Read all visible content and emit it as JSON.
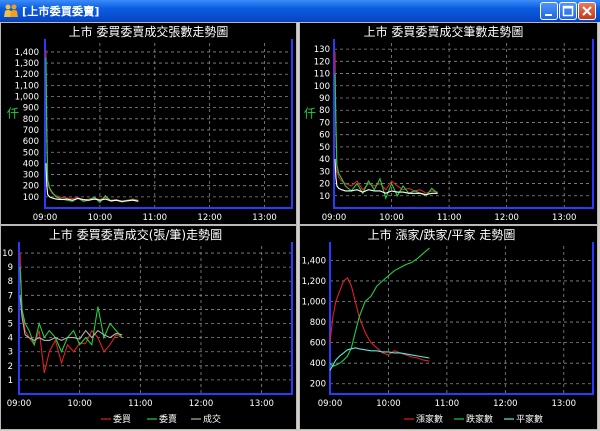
{
  "window": {
    "title": "[上市委買委賣]",
    "colors": {
      "titlebar": "#0a5ce0",
      "axis": "#2a3bff",
      "grid": "#8a8a8a",
      "text": "#ffffff"
    },
    "icons": {
      "app": "people-icon",
      "minimize": "minimize-icon",
      "maximize": "maximize-icon",
      "close": "close-icon"
    }
  },
  "chart_data": [
    {
      "type": "line",
      "title": "上市  委買委賣成交張數走勢圖",
      "ylabel": "仟",
      "x_ticks": [
        "09:00",
        "10:00",
        "11:00",
        "12:00",
        "13:00"
      ],
      "x_range": [
        "09:00",
        "13:30"
      ],
      "ylim": [
        0,
        1480
      ],
      "y_ticks": [
        100,
        200,
        300,
        400,
        500,
        600,
        700,
        800,
        900,
        1000,
        1100,
        1200,
        1300,
        1400
      ],
      "y_tick_labels": [
        "100",
        "200",
        "300",
        "400",
        "500",
        "600",
        "700",
        "800",
        "900",
        "1,000",
        "1,100",
        "1,200",
        "1,300",
        "1,400"
      ],
      "grid": true,
      "legend": "none",
      "series": [
        {
          "color": "#e02020",
          "x": [
            "09:01",
            "09:02",
            "09:03",
            "09:05",
            "09:08",
            "09:12",
            "09:18",
            "09:24",
            "09:30",
            "09:36",
            "09:42",
            "09:48",
            "09:54",
            "10:00",
            "10:06",
            "10:12",
            "10:18",
            "10:24",
            "10:30",
            "10:36",
            "10:42"
          ],
          "values": [
            1420,
            600,
            220,
            170,
            130,
            110,
            95,
            90,
            85,
            95,
            70,
            80,
            90,
            75,
            95,
            70,
            75,
            60,
            70,
            80,
            70
          ]
        },
        {
          "color": "#20d040",
          "x": [
            "09:01",
            "09:02",
            "09:03",
            "09:05",
            "09:08",
            "09:12",
            "09:18",
            "09:24",
            "09:30",
            "09:36",
            "09:42",
            "09:48",
            "09:54",
            "10:00",
            "10:06",
            "10:12",
            "10:18",
            "10:24",
            "10:30",
            "10:36",
            "10:42"
          ],
          "values": [
            1350,
            700,
            250,
            180,
            140,
            100,
            80,
            70,
            60,
            90,
            60,
            70,
            100,
            50,
            110,
            60,
            70,
            55,
            65,
            75,
            65
          ]
        },
        {
          "color": "#ffffff",
          "x": [
            "09:01",
            "09:02",
            "09:03",
            "09:05",
            "09:08",
            "09:12",
            "09:18",
            "09:24",
            "09:30",
            "09:36",
            "09:42",
            "09:48",
            "09:54",
            "10:00",
            "10:06",
            "10:12",
            "10:18",
            "10:24",
            "10:30",
            "10:36",
            "10:42"
          ],
          "values": [
            400,
            200,
            120,
            100,
            90,
            80,
            75,
            80,
            70,
            85,
            75,
            70,
            80,
            70,
            80,
            65,
            70,
            60,
            65,
            70,
            60
          ]
        }
      ]
    },
    {
      "type": "line",
      "title": "上市  委買委賣成交筆數走勢圖",
      "ylabel": "仟",
      "x_ticks": [
        "09:00",
        "10:00",
        "11:00",
        "12:00",
        "13:00"
      ],
      "x_range": [
        "09:00",
        "13:30"
      ],
      "ylim": [
        0,
        135
      ],
      "y_ticks": [
        10,
        20,
        30,
        40,
        50,
        60,
        70,
        80,
        90,
        100,
        110,
        120,
        130
      ],
      "y_tick_labels": [
        "10",
        "20",
        "30",
        "40",
        "50",
        "60",
        "70",
        "80",
        "90",
        "100",
        "110",
        "120",
        "130"
      ],
      "grid": true,
      "legend": "none",
      "series": [
        {
          "color": "#e02020",
          "x": [
            "09:01",
            "09:02",
            "09:03",
            "09:05",
            "09:08",
            "09:12",
            "09:18",
            "09:24",
            "09:30",
            "09:36",
            "09:42",
            "09:48",
            "09:54",
            "10:00",
            "10:06",
            "10:12",
            "10:18",
            "10:24",
            "10:30",
            "10:36",
            "10:42",
            "10:48"
          ],
          "values": [
            128,
            60,
            30,
            25,
            22,
            20,
            18,
            22,
            15,
            20,
            18,
            20,
            15,
            22,
            18,
            15,
            16,
            14,
            15,
            12,
            14,
            13
          ]
        },
        {
          "color": "#20d040",
          "x": [
            "09:01",
            "09:02",
            "09:03",
            "09:05",
            "09:08",
            "09:12",
            "09:18",
            "09:24",
            "09:30",
            "09:36",
            "09:42",
            "09:48",
            "09:54",
            "10:00",
            "10:06",
            "10:12",
            "10:18",
            "10:24",
            "10:30",
            "10:36",
            "10:42",
            "10:48"
          ],
          "values": [
            110,
            70,
            35,
            28,
            24,
            18,
            14,
            20,
            12,
            22,
            15,
            24,
            8,
            20,
            10,
            18,
            12,
            14,
            12,
            10,
            16,
            12
          ]
        },
        {
          "color": "#ffffff",
          "x": [
            "09:01",
            "09:02",
            "09:03",
            "09:05",
            "09:08",
            "09:12",
            "09:18",
            "09:24",
            "09:30",
            "09:36",
            "09:42",
            "09:48",
            "09:54",
            "10:00",
            "10:06",
            "10:12",
            "10:18",
            "10:24",
            "10:30",
            "10:36",
            "10:42",
            "10:48"
          ],
          "values": [
            40,
            25,
            18,
            16,
            15,
            14,
            14,
            15,
            13,
            15,
            14,
            14,
            12,
            14,
            13,
            13,
            12,
            12,
            12,
            11,
            12,
            12
          ]
        }
      ]
    },
    {
      "type": "line",
      "title": "上市  委買委賣成交(張/筆)走勢圖",
      "x_ticks": [
        "09:00",
        "10:00",
        "11:00",
        "12:00",
        "13:00"
      ],
      "x_range": [
        "09:00",
        "13:30"
      ],
      "ylim": [
        0,
        10.5
      ],
      "y_ticks": [
        1,
        2,
        3,
        4,
        5,
        6,
        7,
        8,
        9,
        10
      ],
      "y_tick_labels": [
        "1",
        "2",
        "3",
        "4",
        "5",
        "6",
        "7",
        "8",
        "9",
        "10"
      ],
      "grid": true,
      "legend": "bottom",
      "series": [
        {
          "name": "委買",
          "color": "#e02020",
          "x": [
            "09:01",
            "09:03",
            "09:06",
            "09:10",
            "09:15",
            "09:20",
            "09:25",
            "09:30",
            "09:36",
            "09:42",
            "09:48",
            "09:54",
            "10:00",
            "10:06",
            "10:12",
            "10:18",
            "10:24",
            "10:30",
            "10:36",
            "10:42"
          ],
          "values": [
            10,
            6,
            4.5,
            4,
            3.5,
            4.5,
            1.5,
            3,
            3.8,
            2.2,
            3.5,
            3,
            3.6,
            3.6,
            4.5,
            4,
            3,
            3.5,
            4.2,
            4
          ]
        },
        {
          "name": "委賣",
          "color": "#20d040",
          "x": [
            "09:01",
            "09:03",
            "09:06",
            "09:10",
            "09:15",
            "09:20",
            "09:25",
            "09:30",
            "09:36",
            "09:42",
            "09:48",
            "09:54",
            "10:00",
            "10:06",
            "10:12",
            "10:18",
            "10:24",
            "10:30",
            "10:36",
            "10:42"
          ],
          "values": [
            9,
            6,
            5,
            4.5,
            3.5,
            5,
            4,
            4.5,
            4,
            3,
            4,
            4.5,
            3.5,
            4,
            3.5,
            6.2,
            4,
            5,
            4.5,
            4
          ]
        },
        {
          "name": "成交",
          "color": "#b0b0b0",
          "x": [
            "09:01",
            "09:03",
            "09:06",
            "09:10",
            "09:15",
            "09:20",
            "09:25",
            "09:30",
            "09:36",
            "09:42",
            "09:48",
            "09:54",
            "10:00",
            "10:06",
            "10:12",
            "10:18",
            "10:24",
            "10:30",
            "10:36",
            "10:42"
          ],
          "values": [
            7,
            5.5,
            4.2,
            4,
            3.8,
            4,
            3.8,
            3.8,
            4,
            3.8,
            4,
            4,
            3.9,
            4.5,
            4,
            4.5,
            4.2,
            4,
            4.3,
            4.2
          ]
        }
      ]
    },
    {
      "type": "line",
      "title": "上市  漲家/跌家/平家 走勢圖",
      "x_ticks": [
        "09:00",
        "10:00",
        "11:00",
        "12:00",
        "13:00"
      ],
      "x_range": [
        "09:00",
        "13:30"
      ],
      "ylim": [
        100,
        1540
      ],
      "y_ticks": [
        200,
        400,
        600,
        800,
        1000,
        1200,
        1400
      ],
      "y_tick_labels": [
        "200",
        "400",
        "600",
        "800",
        "1,000",
        "1,200",
        "1,400"
      ],
      "grid": true,
      "legend": "bottom",
      "series": [
        {
          "name": "漲家數",
          "color": "#e02020",
          "x": [
            "09:00",
            "09:03",
            "09:06",
            "09:10",
            "09:14",
            "09:18",
            "09:22",
            "09:26",
            "09:30",
            "09:36",
            "09:42",
            "09:48",
            "09:54",
            "10:00",
            "10:06",
            "10:12",
            "10:18",
            "10:24",
            "10:30",
            "10:36",
            "10:42"
          ],
          "values": [
            600,
            850,
            1000,
            1100,
            1200,
            1230,
            1150,
            1000,
            850,
            700,
            600,
            550,
            500,
            480,
            520,
            500,
            480,
            460,
            450,
            430,
            420
          ]
        },
        {
          "name": "跌家數",
          "color": "#20d040",
          "x": [
            "09:00",
            "09:03",
            "09:06",
            "09:10",
            "09:14",
            "09:18",
            "09:22",
            "09:26",
            "09:30",
            "09:36",
            "09:42",
            "09:48",
            "09:54",
            "10:00",
            "10:06",
            "10:12",
            "10:18",
            "10:24",
            "10:30",
            "10:36",
            "10:42"
          ],
          "values": [
            400,
            370,
            380,
            400,
            430,
            470,
            550,
            700,
            850,
            1000,
            1050,
            1150,
            1200,
            1250,
            1300,
            1330,
            1360,
            1380,
            1420,
            1470,
            1520
          ]
        },
        {
          "name": "平家數",
          "color": "#60e8d8",
          "x": [
            "09:00",
            "09:03",
            "09:06",
            "09:10",
            "09:14",
            "09:18",
            "09:22",
            "09:26",
            "09:30",
            "09:36",
            "09:42",
            "09:48",
            "09:54",
            "10:00",
            "10:06",
            "10:12",
            "10:18",
            "10:24",
            "10:30",
            "10:36",
            "10:42"
          ],
          "values": [
            330,
            380,
            430,
            470,
            500,
            530,
            540,
            550,
            540,
            530,
            520,
            520,
            510,
            510,
            500,
            500,
            490,
            480,
            470,
            460,
            450
          ]
        }
      ]
    }
  ]
}
